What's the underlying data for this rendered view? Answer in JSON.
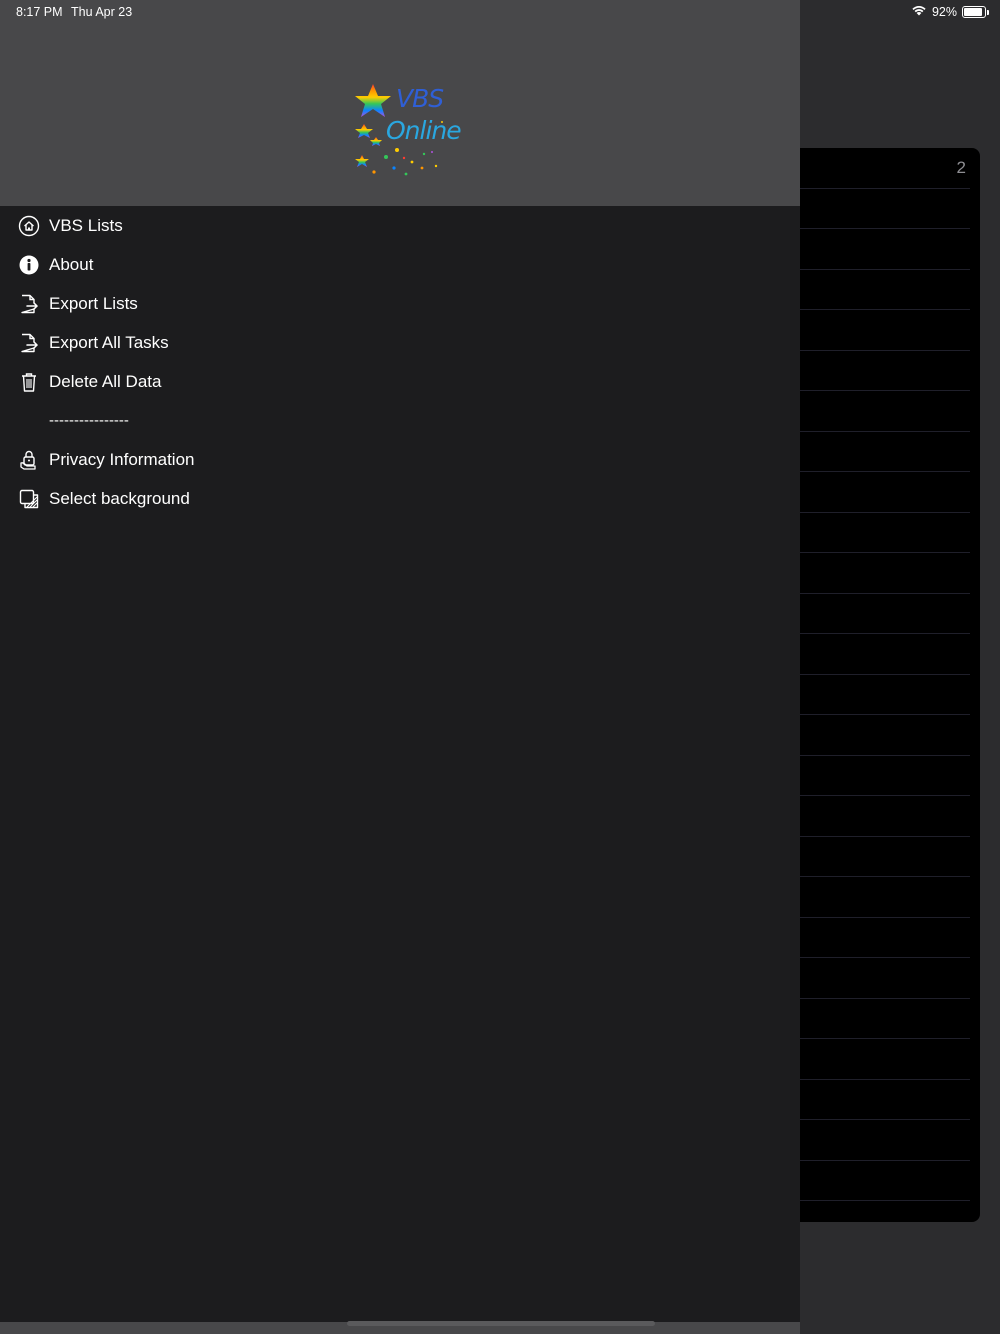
{
  "status_bar": {
    "time": "8:17 PM",
    "date": "Thu Apr 23",
    "battery_percent": "92%",
    "battery_level": 0.92,
    "wifi_icon": "wifi-icon",
    "battery_icon": "battery-icon"
  },
  "header": {
    "logo_line1": "VBS",
    "logo_line2": "Online"
  },
  "menu": {
    "items": [
      {
        "label": "VBS Lists",
        "icon": "home-icon"
      },
      {
        "label": "About",
        "icon": "info-icon"
      },
      {
        "label": "Export Lists",
        "icon": "export-icon"
      },
      {
        "label": "Export All Tasks",
        "icon": "export-icon"
      },
      {
        "label": "Delete All Data",
        "icon": "trash-icon"
      }
    ],
    "separator": "----------------",
    "items_after": [
      {
        "label": "Privacy Information",
        "icon": "privacy-lock-icon"
      },
      {
        "label": "Select background",
        "icon": "background-select-icon"
      }
    ]
  },
  "background_list": {
    "count": "2"
  },
  "colors": {
    "drawer_bg": "#1c1c1e",
    "header_bg": "#48484a",
    "app_bg": "#2c2c2e",
    "text": "#ffffff"
  }
}
